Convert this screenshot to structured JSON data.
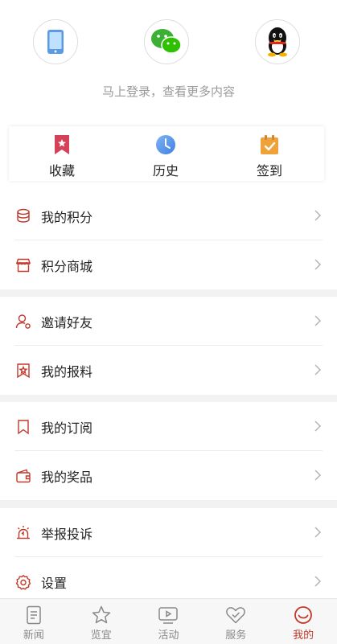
{
  "login": {
    "hint": "马上登录，查看更多内容",
    "options": [
      "phone-icon",
      "wechat-icon",
      "qq-icon"
    ]
  },
  "quick_actions": [
    {
      "label": "收藏",
      "icon": "favorite-bookmark-icon"
    },
    {
      "label": "历史",
      "icon": "history-clock-icon"
    },
    {
      "label": "签到",
      "icon": "sign-in-calendar-icon"
    }
  ],
  "menu_groups": [
    [
      {
        "label": "我的积分",
        "icon": "coins-icon"
      },
      {
        "label": "积分商城",
        "icon": "store-icon"
      }
    ],
    [
      {
        "label": "邀请好友",
        "icon": "invite-user-icon"
      },
      {
        "label": "我的报料",
        "icon": "report-tip-icon"
      }
    ],
    [
      {
        "label": "我的订阅",
        "icon": "subscription-bookmark-icon"
      },
      {
        "label": "我的奖品",
        "icon": "wallet-prize-icon"
      }
    ],
    [
      {
        "label": "举报投诉",
        "icon": "alarm-report-icon"
      },
      {
        "label": "设置",
        "icon": "settings-gear-icon"
      }
    ]
  ],
  "bottom_nav": [
    {
      "label": "新闻",
      "icon": "news-icon",
      "active": false
    },
    {
      "label": "览宜",
      "icon": "star-icon",
      "active": false
    },
    {
      "label": "活动",
      "icon": "tv-play-icon",
      "active": false
    },
    {
      "label": "服务",
      "icon": "heart-check-icon",
      "active": false
    },
    {
      "label": "我的",
      "icon": "profile-smile-icon",
      "active": true
    }
  ],
  "colors": {
    "accent": "#c0392b",
    "icon_red": "#c0392b",
    "wechat": "#2dc100",
    "phone": "#4a90e2"
  }
}
